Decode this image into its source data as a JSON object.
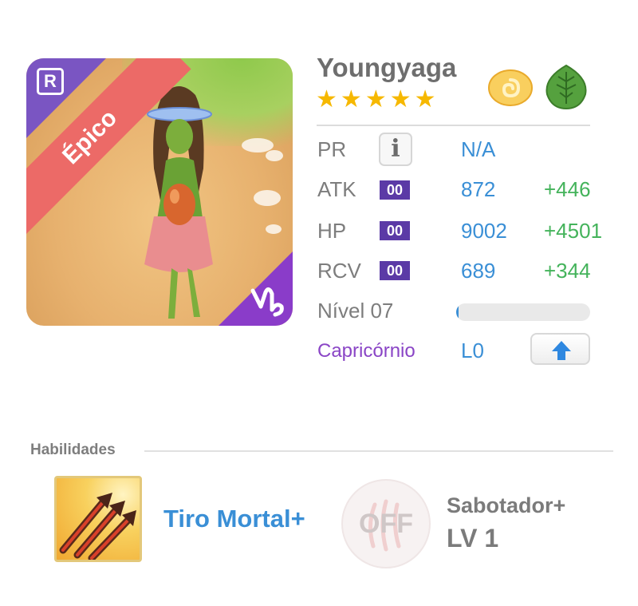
{
  "character": {
    "name": "Youngyaga",
    "stars": 5,
    "rarity": "Épico",
    "badge": "R",
    "elements": [
      "light-element-icon",
      "nature-element-icon"
    ]
  },
  "stats": {
    "pr": {
      "label": "PR",
      "value": "N/A"
    },
    "atk": {
      "label": "ATK",
      "tag": "00",
      "value": "872",
      "bonus": "+446"
    },
    "hp": {
      "label": "HP",
      "tag": "00",
      "value": "9002",
      "bonus": "+4501"
    },
    "rcv": {
      "label": "RCV",
      "tag": "00",
      "value": "689",
      "bonus": "+344"
    },
    "level": {
      "label": "Nível 07",
      "progress": 0.02
    },
    "zodiac": {
      "label": "Capricórnio",
      "value": "L0"
    }
  },
  "skills": {
    "heading": "Habilidades",
    "active": {
      "name": "Tiro Mortal+"
    },
    "leader": {
      "status": "OFF",
      "name": "Sabotador+",
      "level": "LV 1"
    }
  },
  "colors": {
    "accent_blue": "#3a8fd6",
    "bonus_green": "#44b35b",
    "tag_purple": "#5b3aa6",
    "rarity_red": "#ec6a67",
    "star_gold": "#f6b800"
  }
}
